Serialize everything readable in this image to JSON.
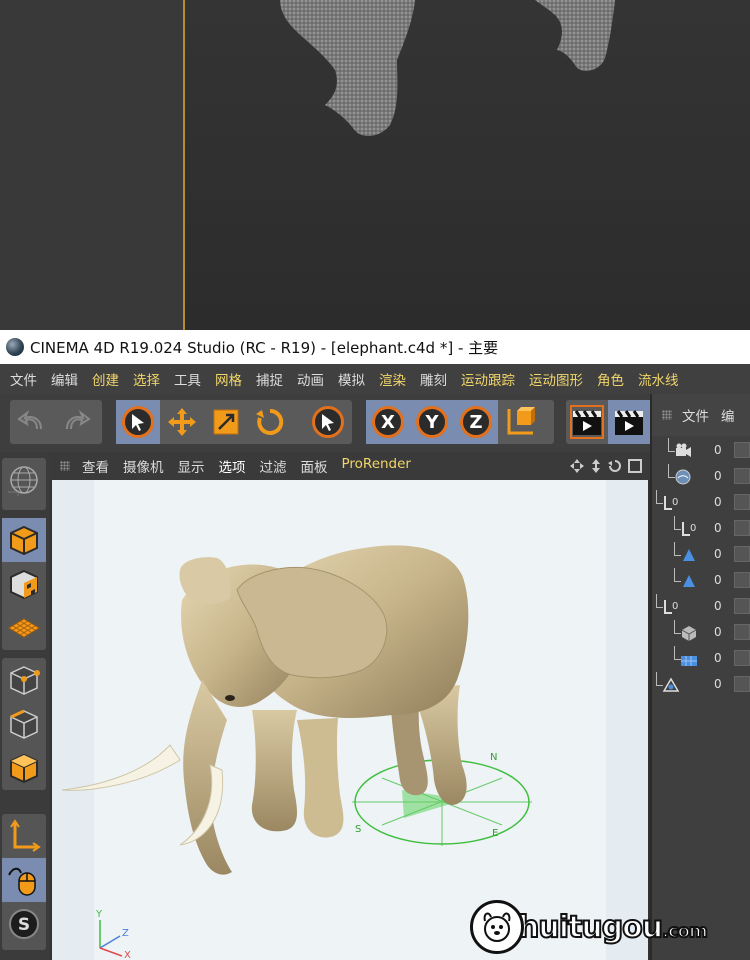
{
  "window": {
    "title": "CINEMA 4D R19.024 Studio (RC - R19) - [elephant.c4d *] - 主要"
  },
  "menu": {
    "items": [
      {
        "label": "文件",
        "color": "#dddddd"
      },
      {
        "label": "编辑",
        "color": "#dddddd"
      },
      {
        "label": "创建",
        "color": "#f0d56a"
      },
      {
        "label": "选择",
        "color": "#f0d56a"
      },
      {
        "label": "工具",
        "color": "#dddddd"
      },
      {
        "label": "网格",
        "color": "#f0d56a"
      },
      {
        "label": "捕捉",
        "color": "#dddddd"
      },
      {
        "label": "动画",
        "color": "#dddddd"
      },
      {
        "label": "模拟",
        "color": "#dddddd"
      },
      {
        "label": "渲染",
        "color": "#f0d56a"
      },
      {
        "label": "雕刻",
        "color": "#dddddd"
      },
      {
        "label": "运动跟踪",
        "color": "#f0d56a"
      },
      {
        "label": "运动图形",
        "color": "#f0d56a"
      },
      {
        "label": "角色",
        "color": "#f0d56a"
      },
      {
        "label": "流水线",
        "color": "#f0d56a"
      }
    ]
  },
  "toolbar": {
    "undo": "undo-icon",
    "redo": "redo-icon",
    "axis_x": "X",
    "axis_y": "Y",
    "axis_z": "Z"
  },
  "viewport": {
    "menu": [
      {
        "label": "查看",
        "color": "#dddddd"
      },
      {
        "label": "摄像机",
        "color": "#dddddd"
      },
      {
        "label": "显示",
        "color": "#dddddd"
      },
      {
        "label": "选项",
        "color": "#ffffff"
      },
      {
        "label": "过滤",
        "color": "#dddddd"
      },
      {
        "label": "面板",
        "color": "#dddddd"
      },
      {
        "label": "ProRender",
        "color": "#f0d56a"
      }
    ],
    "axis_y": "Y",
    "axis_z": "Z",
    "axis_x": "X",
    "compass_n": "N",
    "compass_e": "E",
    "compass_s": "S"
  },
  "objects_panel": {
    "tab_file": "文件",
    "tab_edit": "编",
    "rows": [
      {
        "icon": "camera-icon",
        "count": "0"
      },
      {
        "icon": "sky-icon",
        "count": "0"
      },
      {
        "icon": "null-icon",
        "count": "0"
      },
      {
        "icon": "null-icon",
        "count": "0"
      },
      {
        "icon": "cone-icon",
        "count": "0"
      },
      {
        "icon": "cone-icon",
        "count": "0"
      },
      {
        "icon": "null-icon",
        "count": "0"
      },
      {
        "icon": "cube-icon",
        "count": "0"
      },
      {
        "icon": "plane-icon",
        "count": "0"
      },
      {
        "icon": "light-icon",
        "count": "0"
      }
    ]
  },
  "watermark": {
    "text": "huitugou",
    "suffix": ".com"
  }
}
